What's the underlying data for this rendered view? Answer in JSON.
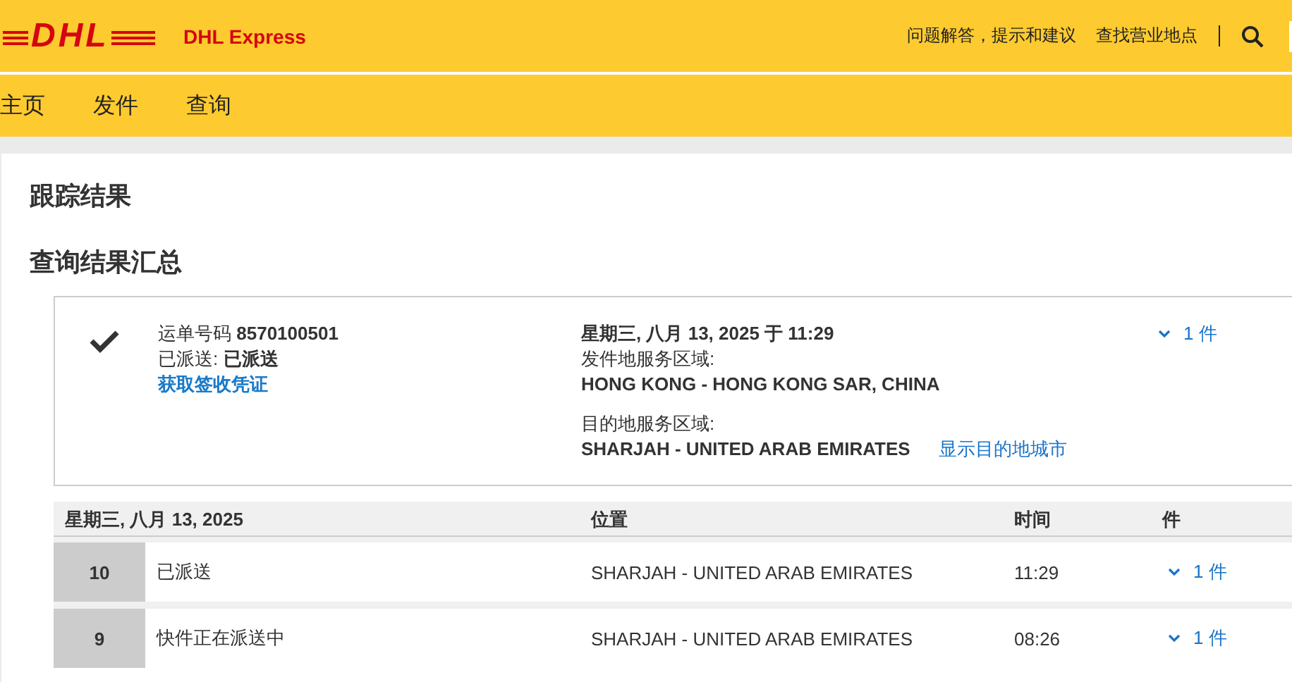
{
  "header": {
    "logo": "DHL",
    "brand": "DHL Express",
    "links": [
      "问题解答，提示和建议",
      "查找营业地点"
    ]
  },
  "nav": [
    "主页",
    "发件",
    "查询"
  ],
  "page_title": "跟踪结果",
  "section_title": "查询结果汇总",
  "summary": {
    "delivered": true,
    "waybill_label": "运单号码",
    "waybill_number": "8570100501",
    "status_label": "已派送:",
    "status": "已派送",
    "proof_link": "获取签收凭证",
    "datetime": "星期三, 八月 13, 2025 于 11:29",
    "origin_label": "发件地服务区域:",
    "origin": "HONG KONG - HONG KONG SAR, CHINA",
    "destination_label": "目的地服务区域:",
    "destination": "SHARJAH - UNITED ARAB EMIRATES",
    "destination_link": "显示目的地城市",
    "pieces": "1 件"
  },
  "events": {
    "columns": [
      "星期三, 八月 13, 2025",
      "位置",
      "时间",
      "件"
    ],
    "rows": [
      {
        "number": "10",
        "description": "已派送",
        "location": "SHARJAH - UNITED ARAB EMIRATES",
        "time": "11:29",
        "pieces": "1 件"
      },
      {
        "number": "9",
        "description": "快件正在派送中",
        "location": "SHARJAH - UNITED ARAB EMIRATES",
        "time": "08:26",
        "pieces": "1 件"
      }
    ]
  }
}
